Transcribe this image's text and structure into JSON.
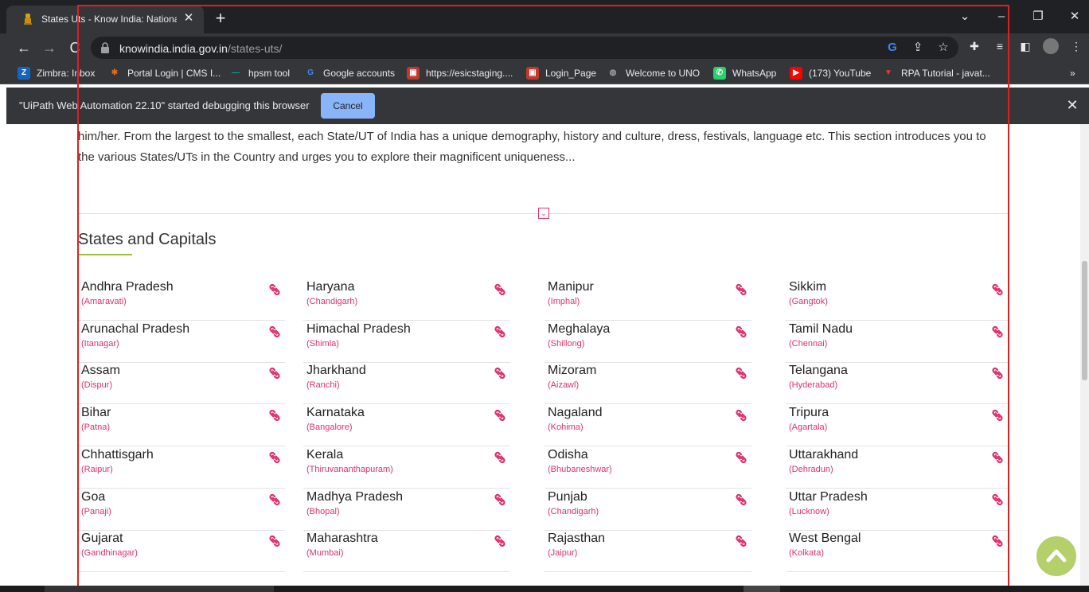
{
  "browser": {
    "tab_title": "States Uts - Know India: National Portal of India",
    "tab_close": "✕",
    "new_tab": "+",
    "url_domain": "knowindia.india.gov.in",
    "url_path": "/states-uts/",
    "window_controls": {
      "dropdown": "⌄",
      "minimize": "–",
      "restore": "❐",
      "close": "✕"
    },
    "nav": {
      "back": "←",
      "forward": "→",
      "reload": "C"
    },
    "bookmarks": [
      {
        "label": "Zimbra: Inbox",
        "icon": "zimbra-icon",
        "color": "#1565c0",
        "glyph": "Z"
      },
      {
        "label": "Portal Login | CMS I...",
        "icon": "cms-icon",
        "color": "#e06b1f",
        "glyph": "✱"
      },
      {
        "label": "hpsm tool",
        "icon": "hpsm-icon",
        "color": "#00a99d",
        "glyph": "—"
      },
      {
        "label": "Google accounts",
        "icon": "google-icon",
        "color": "#ffffff",
        "glyph": "G"
      },
      {
        "label": "https://esicstaging....",
        "icon": "esic-icon",
        "color": "#c0392b",
        "glyph": "▣"
      },
      {
        "label": "Login_Page",
        "icon": "login-page-icon",
        "color": "#c0392b",
        "glyph": "▣"
      },
      {
        "label": "Welcome to UNO",
        "icon": "globe-icon",
        "color": "#9aa0a6",
        "glyph": "◍"
      },
      {
        "label": "WhatsApp",
        "icon": "whatsapp-icon",
        "color": "#25d366",
        "glyph": "✆"
      },
      {
        "label": "(173) YouTube",
        "icon": "youtube-icon",
        "color": "#ff0000",
        "glyph": "▶"
      },
      {
        "label": "RPA Tutorial - javat...",
        "icon": "rpa-icon",
        "color": "#e53935",
        "glyph": "▼"
      }
    ],
    "bookmarks_overflow": "»",
    "infobar": {
      "message": "\"UiPath Web Automation 22.10\" started debugging this browser",
      "cancel_label": "Cancel",
      "close": "✕"
    }
  },
  "page": {
    "intro_text": "him/her. From the largest to the smallest, each State/UT of India has a unique demography, history and culture, dress, festivals, language etc. This section introduces you to the various States/UTs in the Country and urges you to explore their magnificent uniqueness...",
    "section_title": "States and Capitals",
    "collapse_glyph": "⌄",
    "states": [
      [
        {
          "name": "Andhra Pradesh",
          "capital": "(Amaravati)"
        },
        {
          "name": "Arunachal Pradesh",
          "capital": "(Itanagar)"
        },
        {
          "name": "Assam",
          "capital": "(Dispur)"
        },
        {
          "name": "Bihar",
          "capital": "(Patna)"
        },
        {
          "name": "Chhattisgarh",
          "capital": "(Raipur)"
        },
        {
          "name": "Goa",
          "capital": "(Panaji)"
        },
        {
          "name": "Gujarat",
          "capital": "(Gandhinagar)"
        }
      ],
      [
        {
          "name": "Haryana",
          "capital": "(Chandigarh)"
        },
        {
          "name": "Himachal Pradesh",
          "capital": "(Shimla)"
        },
        {
          "name": "Jharkhand",
          "capital": "(Ranchi)"
        },
        {
          "name": "Karnataka",
          "capital": "(Bangalore)"
        },
        {
          "name": "Kerala",
          "capital": "(Thiruvananthapuram)"
        },
        {
          "name": "Madhya Pradesh",
          "capital": "(Bhopal)"
        },
        {
          "name": "Maharashtra",
          "capital": "(Mumbai)"
        }
      ],
      [
        {
          "name": "Manipur",
          "capital": "(Imphal)"
        },
        {
          "name": "Meghalaya",
          "capital": "(Shillong)"
        },
        {
          "name": "Mizoram",
          "capital": "(Aizawl)"
        },
        {
          "name": "Nagaland",
          "capital": "(Kohima)"
        },
        {
          "name": "Odisha",
          "capital": "(Bhubaneshwar)"
        },
        {
          "name": "Punjab",
          "capital": "(Chandigarh)"
        },
        {
          "name": "Rajasthan",
          "capital": "(Jaipur)"
        }
      ],
      [
        {
          "name": "Sikkim",
          "capital": "(Gangtok)"
        },
        {
          "name": "Tamil Nadu",
          "capital": "(Chennai)"
        },
        {
          "name": "Telangana",
          "capital": "(Hyderabad)"
        },
        {
          "name": "Tripura",
          "capital": "(Agartala)"
        },
        {
          "name": "Uttarakhand",
          "capital": "(Dehradun)"
        },
        {
          "name": "Uttar Pradesh",
          "capital": "(Lucknow)"
        },
        {
          "name": "West Bengal",
          "capital": "(Kolkata)"
        }
      ]
    ]
  },
  "colors": {
    "accent": "#e0306b",
    "underline": "#9ec03a",
    "scroll_top_button": "#b5cf6b",
    "highlight_box": "#e02020"
  }
}
